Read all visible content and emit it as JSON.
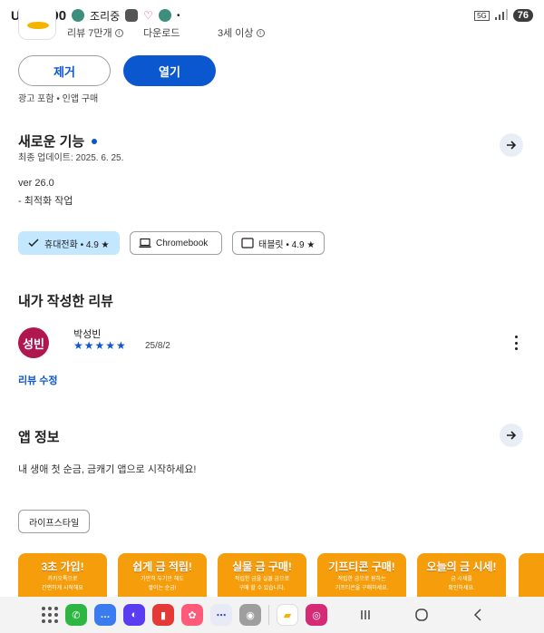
{
  "status_bar": {
    "carrier": "U⁺",
    "time": "11:00",
    "notice": "조리중",
    "battery": "76"
  },
  "stats": [
    {
      "label": "리뷰 7만개",
      "info": "i"
    },
    {
      "label": "다운로드",
      "info": ""
    },
    {
      "label": "3세 이상",
      "info": "i"
    }
  ],
  "actions": {
    "remove_label": "제거",
    "open_label": "열기",
    "ads_note": "광고 포함 • 인앱 구매"
  },
  "whats_new": {
    "title": "새로운 기능",
    "updated": "최종 업데이트: 2025. 6. 25.",
    "version": "ver 26.0",
    "note": "- 최적화 작업"
  },
  "device_chips": [
    {
      "label": "휴대전화 • 4.9 ★",
      "icon": "check-icon"
    },
    {
      "label": "Chromebook",
      "icon": "laptop-icon"
    },
    {
      "label": "태블릿 • 4.9 ★",
      "icon": "tablet-icon"
    }
  ],
  "my_review": {
    "title": "내가 작성한 리뷰",
    "avatar_text": "성빈",
    "reviewer": "박성빈",
    "stars": "★★★★★",
    "rating": 5,
    "date": "25/8/2",
    "edit_label": "리뷰 수정"
  },
  "app_info": {
    "title": "앱 정보",
    "description": "내 생애 첫 순금, 금캐기 앱으로 시작하세요!",
    "tag": "라이프스타일"
  },
  "screenshots": [
    {
      "title": "3초 가입!",
      "sub1": "카카오톡으로",
      "sub2": "간편하게 시작해요"
    },
    {
      "title": "쉽게 금 적립!",
      "sub1": "가만히 두기만 해도",
      "sub2": "쌓이는 순금!"
    },
    {
      "title": "실물 금 구매!",
      "sub1": "적립한 금을 실물 금으로",
      "sub2": "구매 할 수 있습니다."
    },
    {
      "title": "기프티콘 구매!",
      "sub1": "적립한 금으로 원하는",
      "sub2": "기프티콘을 구매하세요."
    },
    {
      "title": "오늘의 금 시세!",
      "sub1": "금 시세를",
      "sub2": "확인하세요."
    }
  ],
  "colors": {
    "primary": "#0b57d0",
    "chip_selected": "#c2e7ff",
    "avatar": "#b0174f",
    "card": "#f59d0a"
  }
}
